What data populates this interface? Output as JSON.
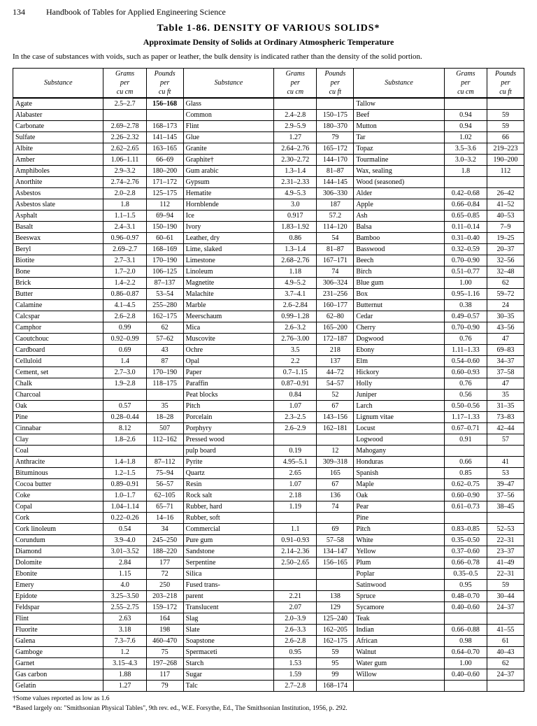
{
  "header": {
    "page_number": "134",
    "book_title": "Handbook of Tables for Applied Engineering Science"
  },
  "table": {
    "title": "Table 1-86.   DENSITY OF VARIOUS SOLIDS*",
    "subtitle": "Approximate Density of Solids at Ordinary Atmospheric Temperature",
    "note": "In the case of substances with voids, such as paper or leather, the bulk density is indicated rather than the density of the solid portion.",
    "col_headers": {
      "substance": "Substance",
      "grams": "Grams per cu cm",
      "pounds": "Pounds per cu ft"
    }
  },
  "footnotes": {
    "f1": "†Some values reported as low as 1.6",
    "f2": "*Based largely on: \"Smithsonian Physical Tables\", 9th rev. ed., W.E. Forsythe, Ed., The Smithsonian Institution, 1956, p. 292."
  }
}
